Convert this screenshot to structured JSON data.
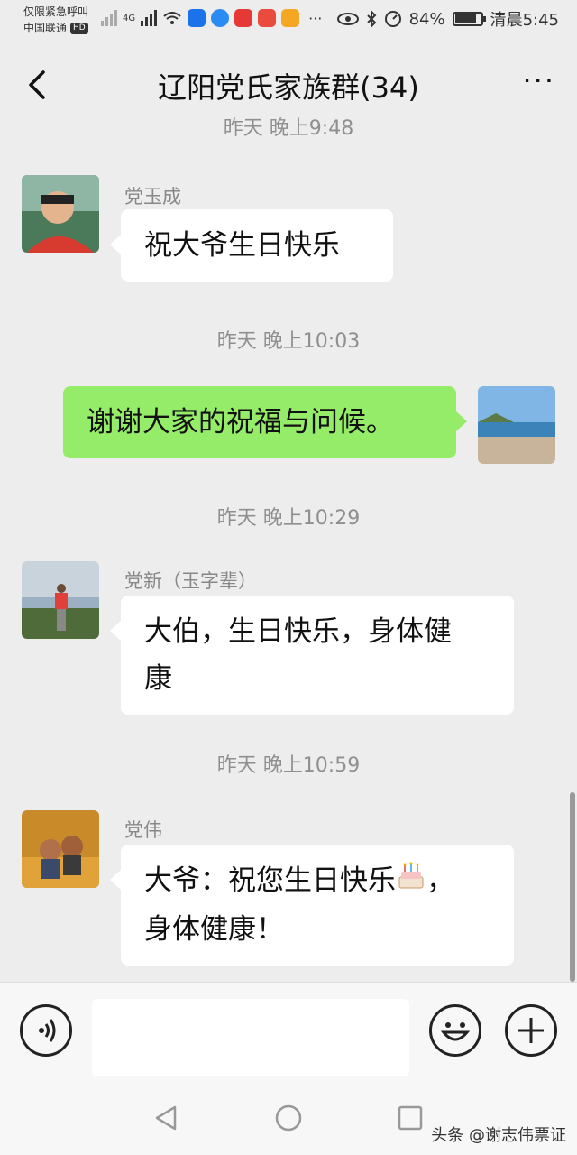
{
  "status_bar": {
    "line1": "仅限紧急呼叫",
    "line2": "中国联通",
    "hd": "HD",
    "network": "4G",
    "more": "···",
    "battery": "84%",
    "battery_level": 0.84,
    "time": "清晨5:45"
  },
  "header": {
    "title": "辽阳党氏家族群(34)",
    "more": "···"
  },
  "chat": {
    "cut_timestamp": "昨天 晚上9:48",
    "messages": [
      {
        "sender": "党玉成",
        "text": "祝大爷生日快乐",
        "direction": "in"
      },
      {
        "timestamp": "昨天 晚上10:03",
        "text": "谢谢大家的祝福与问候。",
        "direction": "out"
      },
      {
        "timestamp": "昨天 晚上10:29",
        "sender": "党新（玉字辈）",
        "text_line1": "大伯，生日快乐，身体健",
        "text_line2": "康",
        "direction": "in"
      },
      {
        "timestamp": "昨天 晚上10:59",
        "sender": "党伟",
        "text_line1": "大爷：祝您生日快乐",
        "text_line1_end": "，",
        "text_line2": "身体健康！",
        "emoji": "birthday-cake",
        "direction": "in"
      }
    ]
  },
  "input_bar": {
    "voice_icon": "voice-icon",
    "emoji_icon": "smile-icon",
    "plus_icon": "plus-icon",
    "placeholder": ""
  },
  "nav_bar": {
    "back": "back-triangle-icon",
    "home": "home-circle-icon",
    "recents": "recents-square-icon"
  },
  "watermark": "头条 @谢志伟票证",
  "colors": {
    "background": "#ededed",
    "out_bubble": "#95ec69",
    "in_bubble": "#ffffff",
    "timestamp": "#8f8f8f"
  }
}
